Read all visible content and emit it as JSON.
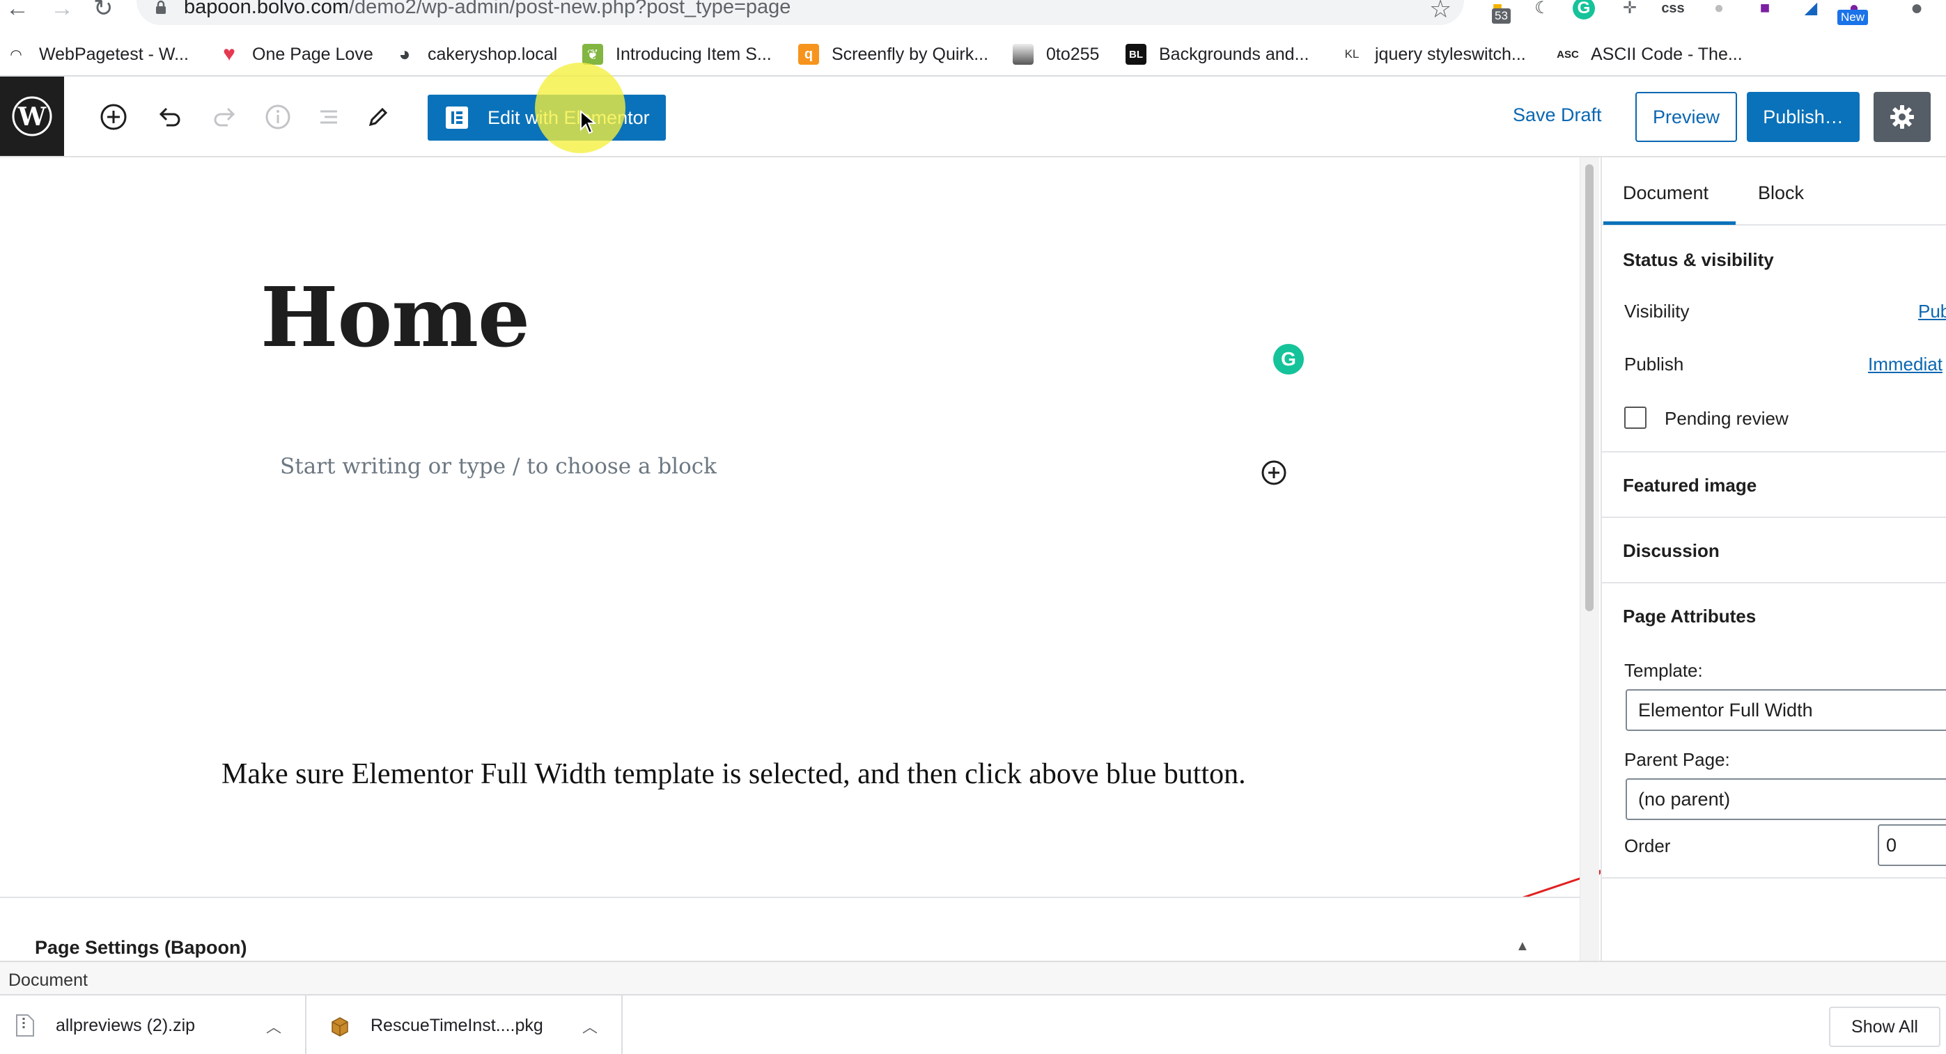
{
  "browser": {
    "url_host": "bapoon.bolvo.com",
    "url_path": "/demo2/wp-admin/post-new.php?post_type=page",
    "extension_badge_count": "53",
    "extension_new_badge": "New",
    "extension_css_label": "css",
    "bookmarks": [
      {
        "label": "WebPagetest - W...",
        "icon": "webpagetest-icon"
      },
      {
        "label": "One Page Love",
        "icon": "heart-icon"
      },
      {
        "label": "cakeryshop.local",
        "icon": "globe-icon"
      },
      {
        "label": "Introducing Item S...",
        "icon": "leaf-icon"
      },
      {
        "label": "Screenfly by Quirk...",
        "icon": "screenfly-icon"
      },
      {
        "label": "0to255",
        "icon": "gradient-icon"
      },
      {
        "label": "Backgrounds and...",
        "icon": "bl-icon"
      },
      {
        "label": "jquery styleswitch...",
        "icon": "kl-icon"
      },
      {
        "label": "ASCII Code - The...",
        "icon": "asc-icon"
      }
    ],
    "bookmark_icon_text": {
      "bl": "BL",
      "kl": "KL",
      "asc": "ASC"
    }
  },
  "editor_header": {
    "elementor_button": "Edit with Elementor",
    "save_draft": "Save Draft",
    "preview": "Preview",
    "publish": "Publish…"
  },
  "editor": {
    "title": "Home",
    "block_placeholder": "Start writing or type / to choose a block",
    "grammarly_letter": "G",
    "annotation": "Make sure Elementor Full Width template is selected, and then click above blue button."
  },
  "meta_box": {
    "title": "Page Settings (Bapoon)"
  },
  "sidebar": {
    "tabs": [
      {
        "label": "Document",
        "active": true
      },
      {
        "label": "Block",
        "active": false
      }
    ],
    "status_visibility": {
      "heading": "Status & visibility",
      "visibility_label": "Visibility",
      "visibility_value": "Pub",
      "publish_label": "Publish",
      "publish_value": "Immediat",
      "pending_review_label": "Pending review",
      "pending_review_checked": false
    },
    "featured_image": "Featured image",
    "discussion": "Discussion",
    "page_attributes": {
      "heading": "Page Attributes",
      "template_label": "Template:",
      "template_value": "Elementor Full Width",
      "parent_label": "Parent Page:",
      "parent_value": "(no parent)",
      "order_label": "Order",
      "order_value": "0"
    }
  },
  "status_bar": {
    "text": "Document"
  },
  "downloads": {
    "items": [
      {
        "filename": "allpreviews (2).zip"
      },
      {
        "filename": "RescueTimeInst....pkg"
      }
    ],
    "show_all": "Show All"
  },
  "colors": {
    "wp_blue": "#0a72ba",
    "link_blue": "#0a67b2",
    "annotation_arrow": "#e02020",
    "grammarly_green": "#15c39a",
    "highlight_yellow": "#f5f03c"
  }
}
